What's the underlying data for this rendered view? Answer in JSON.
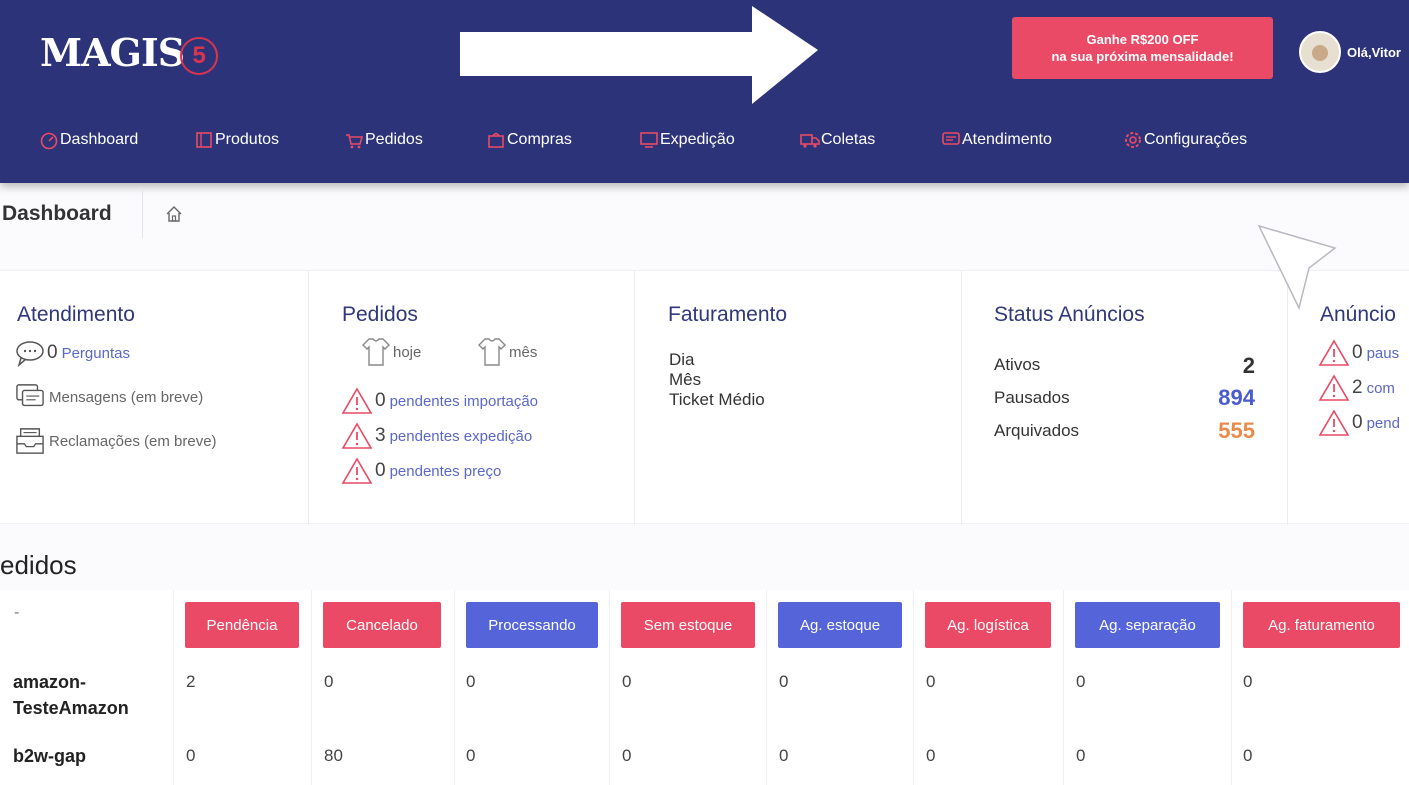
{
  "header": {
    "logo_text": "MAGIS",
    "logo_badge": "5",
    "promo_line1": "Ganhe R$200 OFF",
    "promo_line2": "na sua próxima mensalidade!",
    "greeting": "Olá,Vitor"
  },
  "nav": [
    {
      "label": "Dashboard",
      "icon": "dashboard-icon"
    },
    {
      "label": "Produtos",
      "icon": "products-icon"
    },
    {
      "label": "Pedidos",
      "icon": "orders-icon"
    },
    {
      "label": "Compras",
      "icon": "purchases-icon"
    },
    {
      "label": "Expedição",
      "icon": "shipping-icon"
    },
    {
      "label": "Coletas",
      "icon": "truck-icon"
    },
    {
      "label": "Atendimento",
      "icon": "support-icon"
    },
    {
      "label": "Configurações",
      "icon": "gear-icon"
    }
  ],
  "breadcrumb": {
    "title": "Dashboard",
    "icon": "home-icon"
  },
  "atendimento": {
    "title": "Atendimento",
    "perguntas_count": "0",
    "perguntas_label": "Perguntas",
    "mensagens_label": "Mensagens (em breve)",
    "reclamacoes_label": "Reclamações (em breve)"
  },
  "pedidos_card": {
    "title": "Pedidos",
    "hoje": "hoje",
    "mes": "mês",
    "items": [
      {
        "count": "0",
        "label": "pendentes importação"
      },
      {
        "count": "3",
        "label": "pendentes expedição"
      },
      {
        "count": "0",
        "label": "pendentes preço"
      }
    ]
  },
  "faturamento": {
    "title": "Faturamento",
    "lines": [
      "Dia",
      "Mês",
      "Ticket Médio"
    ]
  },
  "status_anuncios": {
    "title": "Status Anúncios",
    "rows": [
      {
        "label": "Ativos",
        "value": "2",
        "color": "#333333"
      },
      {
        "label": "Pausados",
        "value": "894",
        "color": "#4a5bd0"
      },
      {
        "label": "Arquivados",
        "value": "555",
        "color": "#e98b4a"
      }
    ]
  },
  "anuncios": {
    "title": "Anúncio",
    "items": [
      {
        "count": "0",
        "label": "paus"
      },
      {
        "count": "2",
        "label": "com"
      },
      {
        "count": "0",
        "label": "pend"
      }
    ]
  },
  "orders_table": {
    "title": "edidos",
    "corner": "-",
    "statuses": [
      {
        "label": "Pendência",
        "color": "#ea4a66"
      },
      {
        "label": "Cancelado",
        "color": "#ea4a66"
      },
      {
        "label": "Processando",
        "color": "#5564d8"
      },
      {
        "label": "Sem estoque",
        "color": "#ea4a66"
      },
      {
        "label": "Ag. estoque",
        "color": "#5564d8"
      },
      {
        "label": "Ag. logística",
        "color": "#ea4a66"
      },
      {
        "label": "Ag. separação",
        "color": "#5564d8"
      },
      {
        "label": "Ag. faturamento",
        "color": "#ea4a66"
      }
    ],
    "rows": [
      {
        "name_line1": "amazon-",
        "name_line2": "TesteAmazon",
        "values": [
          "2",
          "0",
          "0",
          "0",
          "0",
          "0",
          "0",
          "0"
        ]
      },
      {
        "name_line1": "b2w-gap",
        "name_line2": "",
        "values": [
          "0",
          "80",
          "0",
          "0",
          "0",
          "0",
          "0",
          "0"
        ]
      }
    ]
  }
}
